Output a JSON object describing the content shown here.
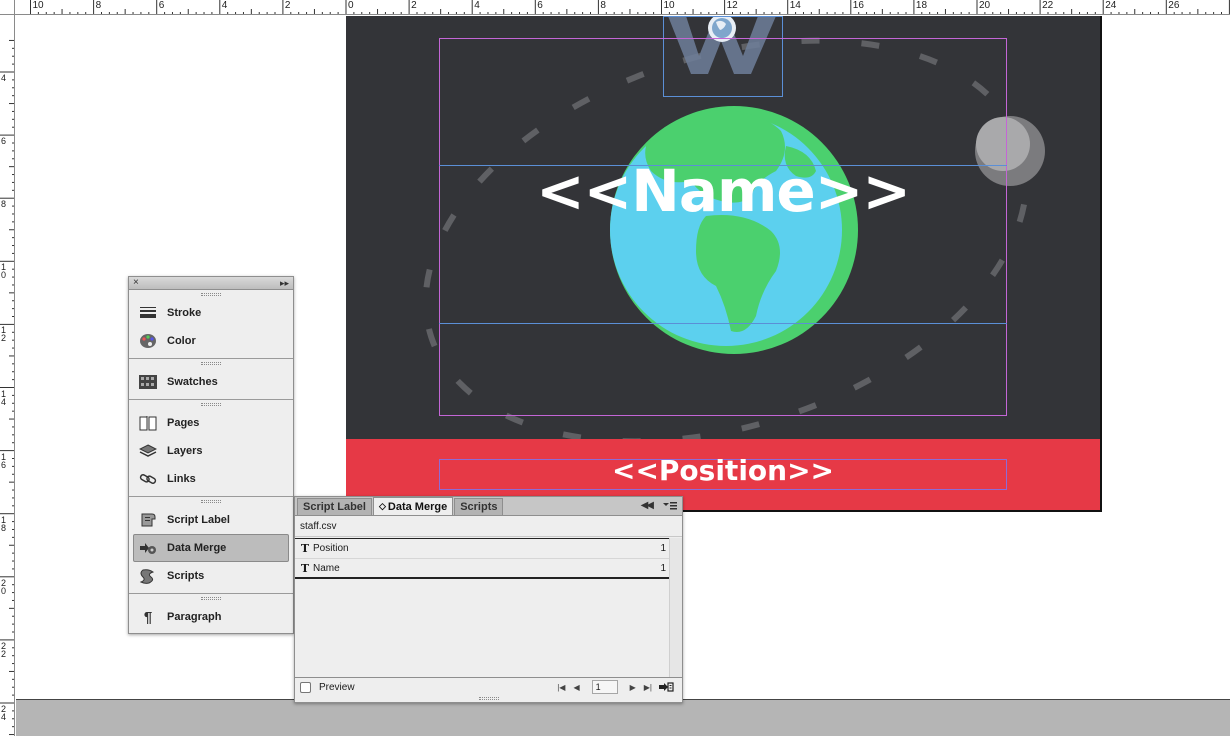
{
  "ruler": {
    "top_labels": [
      "10",
      "8",
      "6",
      "4",
      "2",
      "0",
      "2",
      "4",
      "6",
      "8",
      "10",
      "12",
      "14",
      "16",
      "18",
      "20",
      "22",
      "24",
      "26"
    ],
    "left_labels": [
      "4",
      "6",
      "8",
      "1\n0",
      "1\n2",
      "1\n4",
      "1\n6",
      "1\n8",
      "2\n0",
      "2\n2",
      "2\n4"
    ]
  },
  "document": {
    "name_placeholder": "<<Name>>",
    "position_placeholder": "<<Position>>",
    "colors": {
      "background": "#333438",
      "band": "#e63946",
      "ocean": "#5cd0ee",
      "land": "#4bd06e"
    }
  },
  "panel_strip": {
    "groups": [
      [
        {
          "label": "Stroke",
          "icon": "stroke-icon"
        },
        {
          "label": "Color",
          "icon": "palette-icon"
        }
      ],
      [
        {
          "label": "Swatches",
          "icon": "swatches-icon"
        }
      ],
      [
        {
          "label": "Pages",
          "icon": "pages-icon"
        },
        {
          "label": "Layers",
          "icon": "layers-icon"
        },
        {
          "label": "Links",
          "icon": "links-icon"
        }
      ],
      [
        {
          "label": "Script Label",
          "icon": "script-label-icon"
        },
        {
          "label": "Data Merge",
          "icon": "data-merge-icon"
        },
        {
          "label": "Scripts",
          "icon": "scripts-icon"
        }
      ],
      [
        {
          "label": "Paragraph",
          "icon": "pilcrow-icon"
        }
      ]
    ],
    "active": "Data Merge"
  },
  "data_merge": {
    "tabs": [
      "Script Label",
      "Data Merge",
      "Scripts"
    ],
    "active_tab": "Data Merge",
    "active_tab_prefix": "◇",
    "source_file": "staff.csv",
    "fields": [
      {
        "name": "Position",
        "count": "1"
      },
      {
        "name": "Name",
        "count": "1"
      }
    ],
    "preview_label": "Preview",
    "record": "1"
  }
}
